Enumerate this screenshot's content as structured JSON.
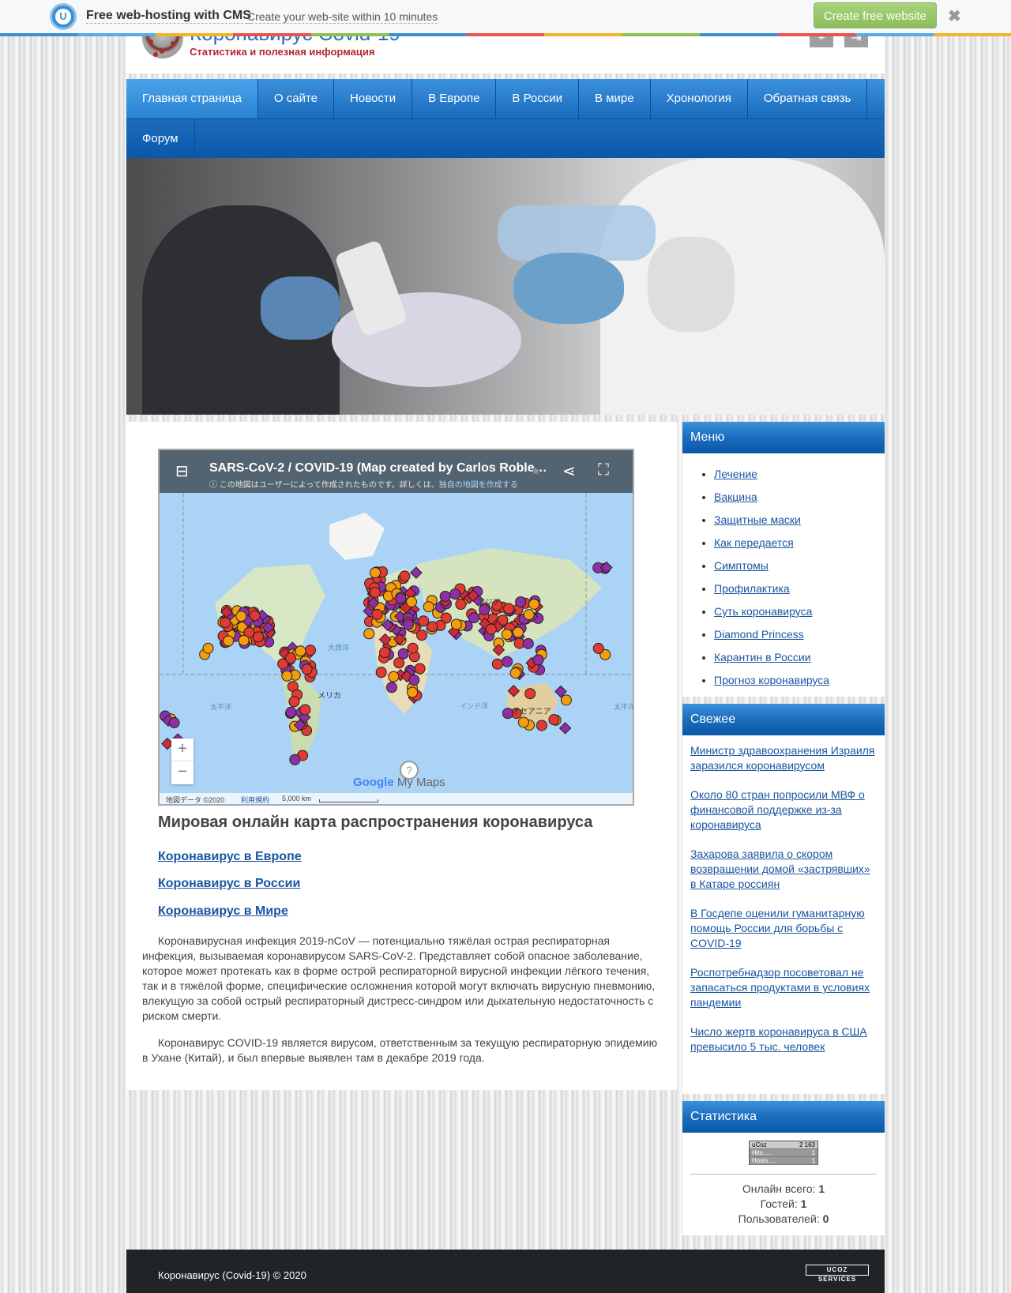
{
  "promo": {
    "title": "Free web-hosting with CMS",
    "subtitle": "Create your web-site within 10 minutes",
    "button": "Create free website",
    "logo_letter": "U",
    "close_icon": "✖",
    "stripe_colors": [
      "#3d8fd1",
      "#5aa9e6",
      "#f0b429",
      "#e8554e",
      "#8cc152",
      "#3d8fd1",
      "#e8554e",
      "#f0b429",
      "#8cc152",
      "#3d8fd1",
      "#e8554e",
      "#5aa9e6",
      "#f0b429"
    ]
  },
  "header": {
    "title": "Коронавирус Covid-19",
    "slogan": "Статистика и полезная информация",
    "register_icon": "user-add-icon",
    "login_icon": "login-icon"
  },
  "nav": {
    "row1": [
      "Главная страница",
      "О сайте",
      "Новости",
      "В Европе",
      "В России",
      "В мире",
      "Хронология",
      "Обратная связь"
    ],
    "row2": [
      "Форум"
    ]
  },
  "map": {
    "title": "SARS-CoV-2 / COVID-19 (Map created by Carlos Roble…",
    "note": "この地図はユーザーによって作成されたものです。詳しくは、",
    "note_link": "独自の地図を作成する",
    "zoom_in": "+",
    "zoom_out": "−",
    "help": "?",
    "brand_google": "Google",
    "brand_mymaps": "My Maps",
    "footer_data": "地図データ ©2020",
    "footer_terms": "利用規約",
    "footer_scale": "5,000 km",
    "labels": {
      "asia": "アジア",
      "america": "メリカ",
      "oceania": "オセアニア",
      "atlantic": "大西洋",
      "pacific_left": "太平洋",
      "pacific_right": "太平洋",
      "indian": "インド洋"
    },
    "legend_colors": {
      "red": "#e03a32",
      "orange": "#f59e0b",
      "purple": "#8e2fa6",
      "diamond": "#d2293a"
    }
  },
  "content": {
    "heading": "Мировая онлайн карта распространения коронавируса",
    "links": [
      "Коронавирус в Европе",
      "Коронавирус в России",
      "Коронавирус в Мире"
    ],
    "paragraphs": [
      "Коронавирусная инфекция 2019-nCoV — потенциально тяжёлая острая респираторная инфекция, вызываемая коронавирусом SARS-CoV-2. Представляет собой опасное заболевание, которое может протекать как в форме острой респираторной вирусной инфекции лёгкого течения, так и в тяжёлой форме, специфические осложнения которой могут включать вирусную пневмонию, влекущую за собой острый респираторный дистресс-синдром или дыхательную недостаточность с риском смерти.",
      "Коронавирус COVID-19 является вирусом, ответственным за текущую респираторную эпидемию в Ухане (Китай), и был впервые выявлен там в декабре 2019 года."
    ]
  },
  "sidebar": {
    "menu_title": "Меню",
    "menu_items": [
      "Лечение",
      "Вакцина",
      "Защитные маски",
      "Как передается",
      "Симптомы",
      "Профилактика",
      "Суть коронавируса",
      "Diamond Princess",
      "Карантин в России",
      "Прогноз коронавируса"
    ],
    "fresh_title": "Свежее",
    "fresh_items": [
      "Министр здравоохранения Израиля заразился коронавирусом",
      "Около 80 стран попросили МВФ о финансовой поддержке из-за коронавируса",
      "Захарова заявила о скором возвращении домой «застрявших» в Катаре россиян",
      "В Госдепе оценили гуманитарную помощь России для борьбы с COVID-19",
      "Роспотребнадзор посоветовал не запасаться продуктами в условиях пандемии",
      "Число жертв коронавируса в США превысило 5 тыс. человек"
    ],
    "stats_title": "Статистика",
    "counter": {
      "brand": "uCoz",
      "total": "2 163",
      "hits_label": "Hits.....",
      "hits": "1",
      "hosts_label": "Hosts....",
      "hosts": "1"
    },
    "online_label": "Онлайн всего:",
    "online_value": "1",
    "guests_label": "Гостей:",
    "guests_value": "1",
    "users_label": "Пользователей:",
    "users_value": "0"
  },
  "footer": {
    "text": "Коронавирус (Covid-19) © 2020",
    "badge": "UCOZ SERVICES"
  }
}
